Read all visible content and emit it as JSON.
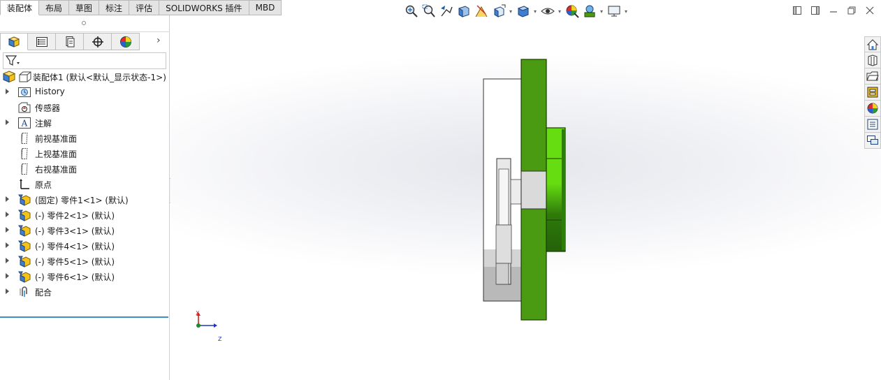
{
  "command_tabs": [
    {
      "label": "装配体",
      "active": true
    },
    {
      "label": "布局"
    },
    {
      "label": "草图"
    },
    {
      "label": "标注"
    },
    {
      "label": "评估"
    },
    {
      "label": "SOLIDWORKS 插件"
    },
    {
      "label": "MBD"
    }
  ],
  "manager_tabs": [
    "featuremanager-icon",
    "propertymanager-icon",
    "configurationmanager-icon",
    "dimxpert-icon",
    "display-manager-icon"
  ],
  "tree": {
    "root": {
      "label": "装配体1  (默认<默认_显示状态-1>)"
    },
    "items": [
      {
        "label": "History",
        "icon": "history-icon",
        "expandable": true
      },
      {
        "label": "传感器",
        "icon": "sensor-icon",
        "expandable": false
      },
      {
        "label": "注解",
        "icon": "annotation-icon",
        "expandable": true
      },
      {
        "label": "前视基准面",
        "icon": "plane-icon",
        "expandable": false
      },
      {
        "label": "上视基准面",
        "icon": "plane-icon",
        "expandable": false
      },
      {
        "label": "右视基准面",
        "icon": "plane-icon",
        "expandable": false
      },
      {
        "label": "原点",
        "icon": "origin-icon",
        "expandable": false
      },
      {
        "label": "(固定) 零件1<1> (默认)",
        "icon": "part-icon",
        "expandable": true
      },
      {
        "label": "(-) 零件2<1> (默认)",
        "icon": "part-icon",
        "expandable": true
      },
      {
        "label": "(-) 零件3<1> (默认)",
        "icon": "part-icon",
        "expandable": true
      },
      {
        "label": "(-) 零件4<1> (默认)",
        "icon": "part-icon",
        "expandable": true
      },
      {
        "label": "(-) 零件5<1> (默认)",
        "icon": "part-icon",
        "expandable": true
      },
      {
        "label": "(-) 零件6<1> (默认)",
        "icon": "part-icon",
        "expandable": true
      },
      {
        "label": "配合",
        "icon": "mates-icon",
        "expandable": true
      }
    ]
  },
  "hud_toolbar": [
    "zoom-to-fit-icon",
    "zoom-to-area-icon",
    "previous-view-icon",
    "section-view-icon",
    "dynamic-annotation-icon",
    "view-orientation-icon",
    "display-style-icon",
    "hide-show-icon",
    "edit-appearance-icon",
    "apply-scene-icon",
    "view-settings-icon"
  ],
  "triad": {
    "x_label": "X",
    "z_label": "Z"
  },
  "colors": {
    "green_part": "#4a9a12",
    "bright_green": "#66dd11",
    "active_tab_border": "#3a8fc4"
  }
}
